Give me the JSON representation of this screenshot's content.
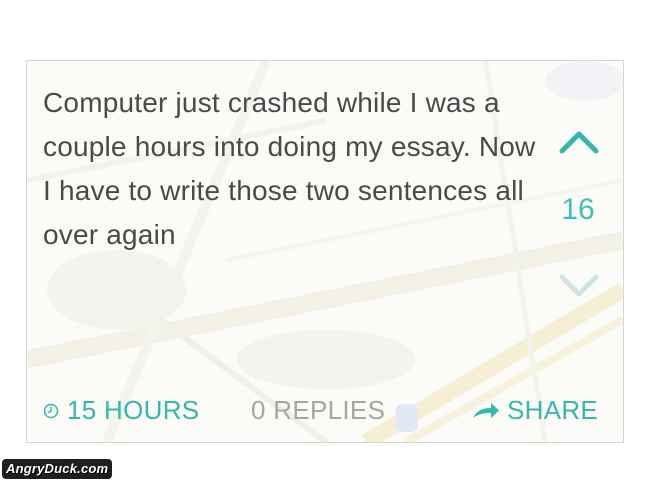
{
  "post": {
    "text": "Computer just crashed while I was a couple hours into doing my essay. Now I have to write those two sentences all over again"
  },
  "vote": {
    "count": "16",
    "up_icon": "chevron-up-icon",
    "down_icon": "chevron-down-icon"
  },
  "footer": {
    "time_label": "15 HOURS",
    "replies_label": "0 REPLIES",
    "share_label": "SHARE"
  },
  "watermark": {
    "text": "AngryDuck.com"
  },
  "colors": {
    "accent": "#36b7ae",
    "text": "#4a4a4a",
    "muted": "#a6a6a6",
    "downvote": "#cfe3e6"
  }
}
